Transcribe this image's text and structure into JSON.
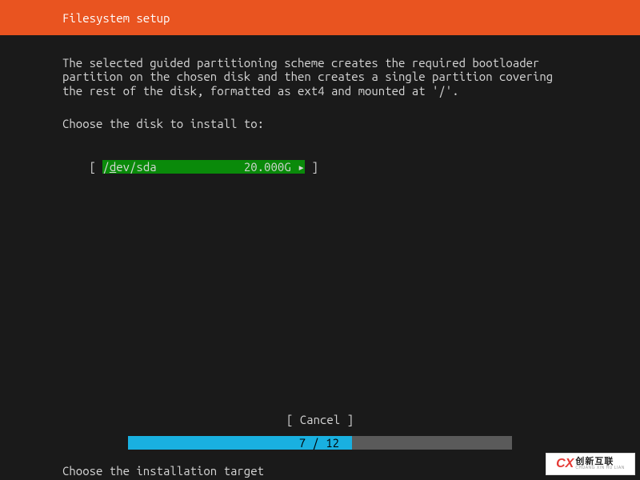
{
  "header": {
    "title": "Filesystem setup"
  },
  "description": "The selected guided partitioning scheme creates the required bootloader partition on the chosen disk and then creates a single partition covering the rest of the disk, formatted as ext4 and mounted at '/'.",
  "prompt": "Choose the disk to install to:",
  "disk_option": {
    "left_bracket": "[ ",
    "path_prefix": "/",
    "path_underline": "d",
    "path_rest": "ev/sda",
    "size": "20.000G",
    "arrow": "▸",
    "right_bracket": " ]"
  },
  "cancel": {
    "label": "[ Cancel     ]"
  },
  "progress": {
    "current": 7,
    "total": 12,
    "label": "7 / 12"
  },
  "footer": "Choose the installation target",
  "watermark": {
    "logo": "CX",
    "top": "创新互联",
    "bottom": "CHUANG XIN HU LIAN"
  }
}
